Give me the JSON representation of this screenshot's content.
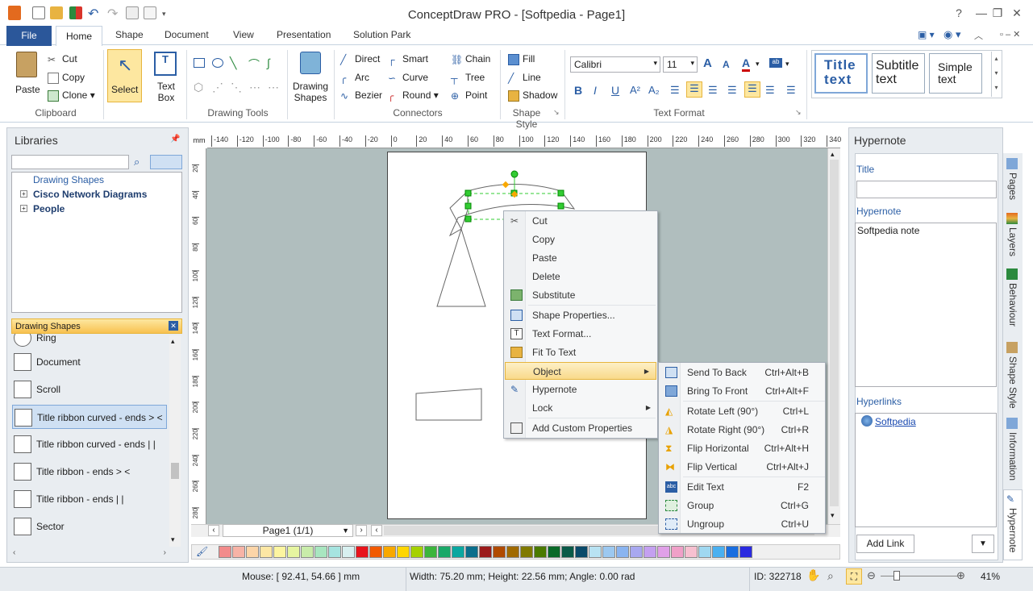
{
  "window": {
    "title": "ConceptDraw PRO - [Softpedia - Page1]"
  },
  "tabs": {
    "file": "File",
    "home": "Home",
    "shape": "Shape",
    "document": "Document",
    "view": "View",
    "presentation": "Presentation",
    "solution_park": "Solution Park"
  },
  "clipboard": {
    "paste": "Paste",
    "cut": "Cut",
    "copy": "Copy",
    "clone": "Clone",
    "group": "Clipboard"
  },
  "select_label": "Select",
  "textbox_label": "Text Box",
  "drawing_tools_group": "Drawing Tools",
  "drawing_shapes_label": "Drawing Shapes",
  "connectors": {
    "direct": "Direct",
    "arc": "Arc",
    "bezier": "Bezier",
    "smart": "Smart",
    "curve": "Curve",
    "round": "Round",
    "chain": "Chain",
    "tree": "Tree",
    "point": "Point",
    "group": "Connectors"
  },
  "shape_style": {
    "fill": "Fill",
    "line": "Line",
    "shadow": "Shadow",
    "group": "Shape Style"
  },
  "text_format": {
    "font": "Calibri",
    "size": "11",
    "group": "Text Format"
  },
  "text_styles": {
    "title_line1": "Title",
    "title_line2": "text",
    "subtitle_line1": "Subtitle",
    "subtitle_line2": "text",
    "simple_line1": "Simple",
    "simple_line2": "text"
  },
  "libraries": {
    "header": "Libraries",
    "tree": [
      {
        "label": "Drawing Shapes"
      },
      {
        "label": "Cisco Network Diagrams"
      },
      {
        "label": "People"
      }
    ],
    "active_library": "Drawing Shapes",
    "items": [
      {
        "label": "Ring"
      },
      {
        "label": "Document"
      },
      {
        "label": "Scroll"
      },
      {
        "label": "Title ribbon curved - ends > <"
      },
      {
        "label": "Title ribbon curved - ends | |"
      },
      {
        "label": "Title ribbon - ends > <"
      },
      {
        "label": "Title ribbon - ends | |"
      },
      {
        "label": "Sector"
      }
    ]
  },
  "ruler": {
    "unit": "mm",
    "h_ticks": [
      "-140",
      "-120",
      "-100",
      "-80",
      "-60",
      "-40",
      "-20",
      "0",
      "20",
      "40",
      "60",
      "80",
      "100",
      "120",
      "140",
      "160",
      "180",
      "200",
      "220",
      "240",
      "260",
      "280",
      "300",
      "320",
      "340"
    ],
    "v_ticks": [
      "20",
      "40",
      "60",
      "80",
      "100",
      "120",
      "140",
      "160",
      "180",
      "200",
      "220",
      "240",
      "260",
      "280"
    ]
  },
  "page_nav": {
    "label": "Page1 (1/1)"
  },
  "context_menu": {
    "items": [
      {
        "label": "Cut"
      },
      {
        "label": "Copy"
      },
      {
        "label": "Paste"
      },
      {
        "label": "Delete"
      },
      {
        "label": "Substitute"
      },
      {
        "label": "Shape Properties..."
      },
      {
        "label": "Text Format..."
      },
      {
        "label": "Fit To Text"
      },
      {
        "label": "Object"
      },
      {
        "label": "Hypernote"
      },
      {
        "label": "Lock"
      },
      {
        "label": "Add Custom Properties"
      }
    ]
  },
  "submenu": {
    "items": [
      {
        "label": "Send To Back",
        "shortcut": "Ctrl+Alt+B"
      },
      {
        "label": "Bring To Front",
        "shortcut": "Ctrl+Alt+F"
      },
      {
        "label": "Rotate Left (90°)",
        "shortcut": "Ctrl+L"
      },
      {
        "label": "Rotate Right (90°)",
        "shortcut": "Ctrl+R"
      },
      {
        "label": "Flip Horizontal",
        "shortcut": "Ctrl+Alt+H"
      },
      {
        "label": "Flip Vertical",
        "shortcut": "Ctrl+Alt+J"
      },
      {
        "label": "Edit Text",
        "shortcut": "F2"
      },
      {
        "label": "Group",
        "shortcut": "Ctrl+G"
      },
      {
        "label": "Ungroup",
        "shortcut": "Ctrl+U"
      }
    ]
  },
  "hypernote": {
    "header": "Hypernote",
    "title_label": "Title",
    "title_value": "",
    "hypernote_label": "Hypernote",
    "hypernote_value": "Softpedia note",
    "hyperlinks_label": "Hyperlinks",
    "link": "Softpedia",
    "add_link": "Add Link"
  },
  "side_tabs": [
    "Pages",
    "Layers",
    "Behaviour",
    "Shape Style",
    "Information",
    "Hypernote"
  ],
  "status": {
    "mouse": "Mouse: [ 92.41, 54.66 ] mm",
    "size": "Width: 75.20 mm;  Height: 22.56 mm;  Angle: 0.00 rad",
    "id": "ID: 322718",
    "zoom": "41%"
  },
  "palette": [
    "#f28b8b",
    "#f7b3a6",
    "#fcd5a8",
    "#fde7a4",
    "#fdf5a0",
    "#e6f5a0",
    "#c9ecaa",
    "#a8e6c0",
    "#a6e4e0",
    "#d8f0f0",
    "#e8141b",
    "#f25a00",
    "#f8a800",
    "#ffd600",
    "#a5d100",
    "#3cb53c",
    "#1aa868",
    "#0aa7a0",
    "#0a6e8c",
    "#9b1b1b",
    "#b04a00",
    "#a06a00",
    "#807a00",
    "#4a7a00",
    "#0a6a28",
    "#0a5a48",
    "#0a4a6a",
    "#b8e2f2",
    "#9cc8f0",
    "#8ab4f0",
    "#a8a8f0",
    "#c4a0f0",
    "#e0a0e8",
    "#f0a0c8",
    "#f7c0d0",
    "#a0d8f0",
    "#4ab0f0",
    "#1a6ee0",
    "#2a2ae0"
  ]
}
